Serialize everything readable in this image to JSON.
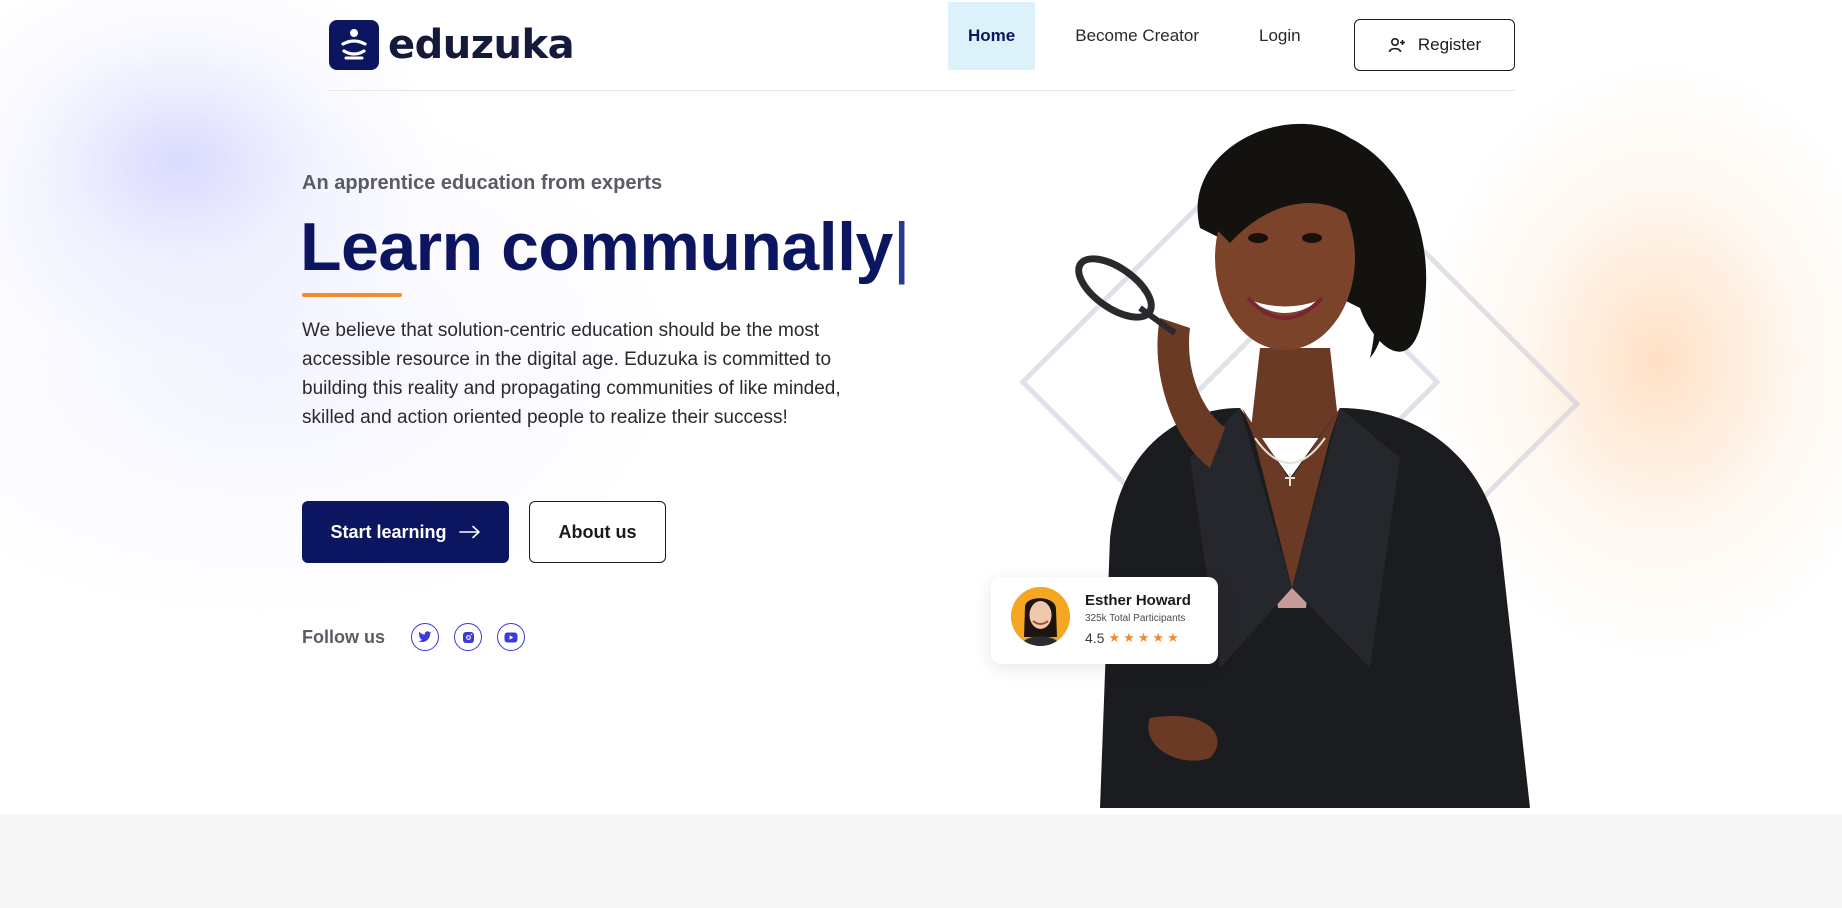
{
  "brand": {
    "name": "eduzuka",
    "primary_color": "#0c1660",
    "accent_color": "#f28a2e"
  },
  "nav": {
    "items": [
      {
        "label": "Home",
        "active": true
      },
      {
        "label": "Become Creator",
        "active": false
      },
      {
        "label": "Login",
        "active": false
      }
    ],
    "register_label": "Register"
  },
  "hero": {
    "eyebrow": "An apprentice education from experts",
    "headline": "Learn communally",
    "caret": "|",
    "description": "We believe that solution-centric education should be the most accessible resource in the digital age. Eduzuka is committed to building this reality and propagating communities of like minded, skilled and action oriented people to realize their success!",
    "primary_button": "Start learning",
    "secondary_button": "About us",
    "follow_label": "Follow us",
    "socials": [
      "twitter-icon",
      "instagram-icon",
      "youtube-icon"
    ]
  },
  "rating_card": {
    "name": "Esther Howard",
    "participants": "325k Total Participants",
    "score": "4.5",
    "stars": "★★★★★"
  }
}
